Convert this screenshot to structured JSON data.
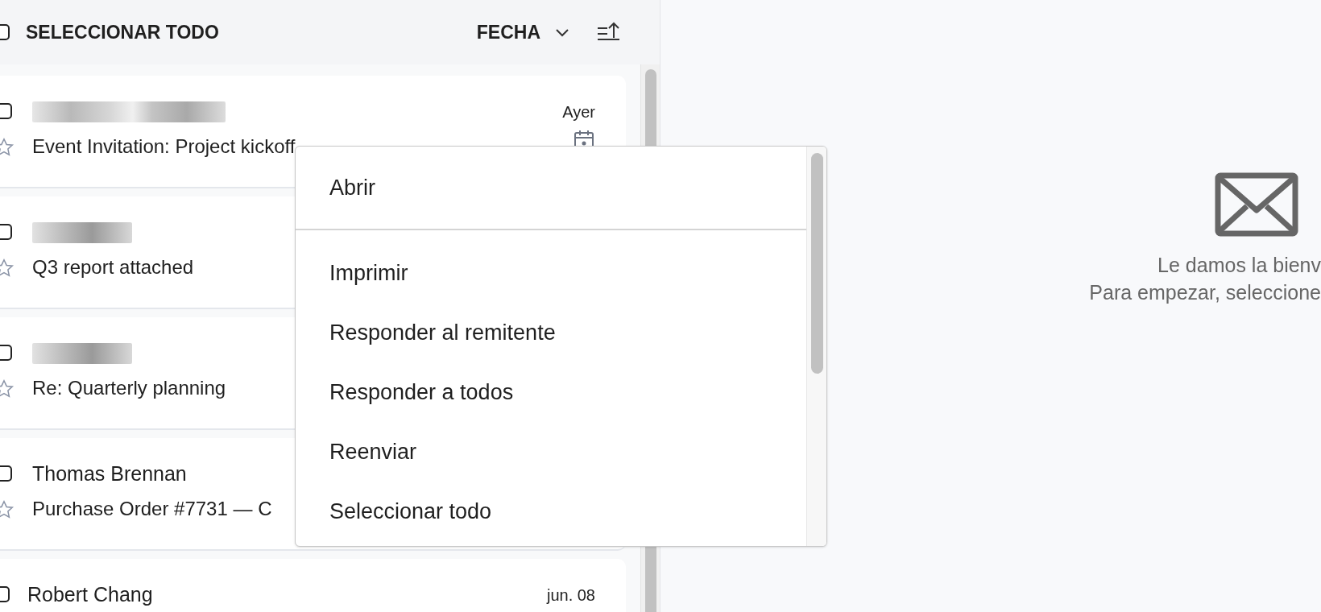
{
  "list_header": {
    "select_all": {
      "label": "SELECCIONAR TODO",
      "checked": false
    },
    "sort": {
      "label": "FECHA"
    }
  },
  "messages": [
    {
      "kind": "blurred",
      "date": "Ayer",
      "subject": "Event Invitation: Project kickoff",
      "checked": false,
      "starred": false,
      "invite": true
    },
    {
      "kind": "blurred",
      "subject": "Q3 report attached",
      "checked": false,
      "starred": false,
      "invite": false
    },
    {
      "kind": "blurred",
      "subject": "Re: Quarterly planning",
      "checked": false,
      "starred": false,
      "invite": false
    },
    {
      "kind": "named",
      "sender": "Thomas Brennan",
      "subject": "Purchase Order #7731 — C",
      "checked": false,
      "starred": false,
      "invite": false
    },
    {
      "kind": "named",
      "sender": "Robert Chang",
      "date": "jun. 08",
      "checked": false
    }
  ],
  "context_menu": {
    "groups": [
      [
        "Abrir"
      ],
      [
        "Imprimir",
        "Responder al remitente",
        "Responder a todos",
        "Reenviar",
        "Seleccionar todo"
      ]
    ]
  },
  "reading_pane": {
    "lines": [
      "Le damos la bienv",
      "Para empezar, seleccione"
    ]
  }
}
